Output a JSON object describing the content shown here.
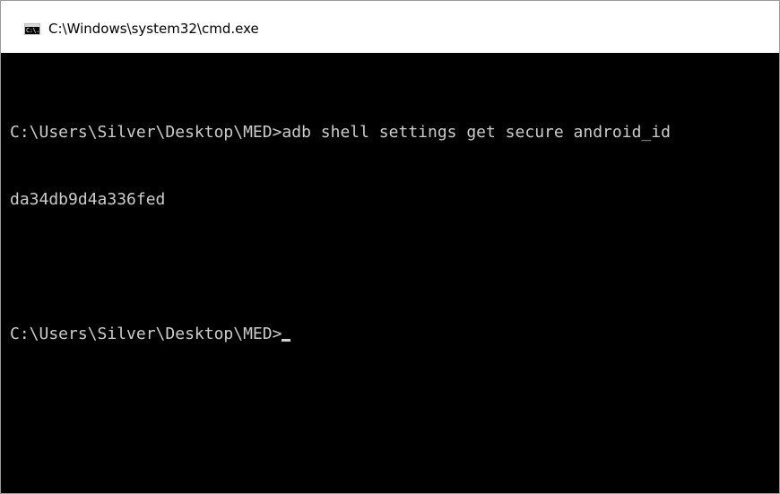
{
  "window": {
    "title": "C:\\Windows\\system32\\cmd.exe",
    "icon": "cmd-icon",
    "icon_glyph": "C:\\."
  },
  "console": {
    "lines": [
      "C:\\Users\\Silver\\Desktop\\MED>adb shell settings get secure android_id",
      "da34db9d4a336fed",
      "",
      "C:\\Users\\Silver\\Desktop\\MED>"
    ],
    "colors": {
      "background": "#000000",
      "text": "#cccccc"
    }
  }
}
